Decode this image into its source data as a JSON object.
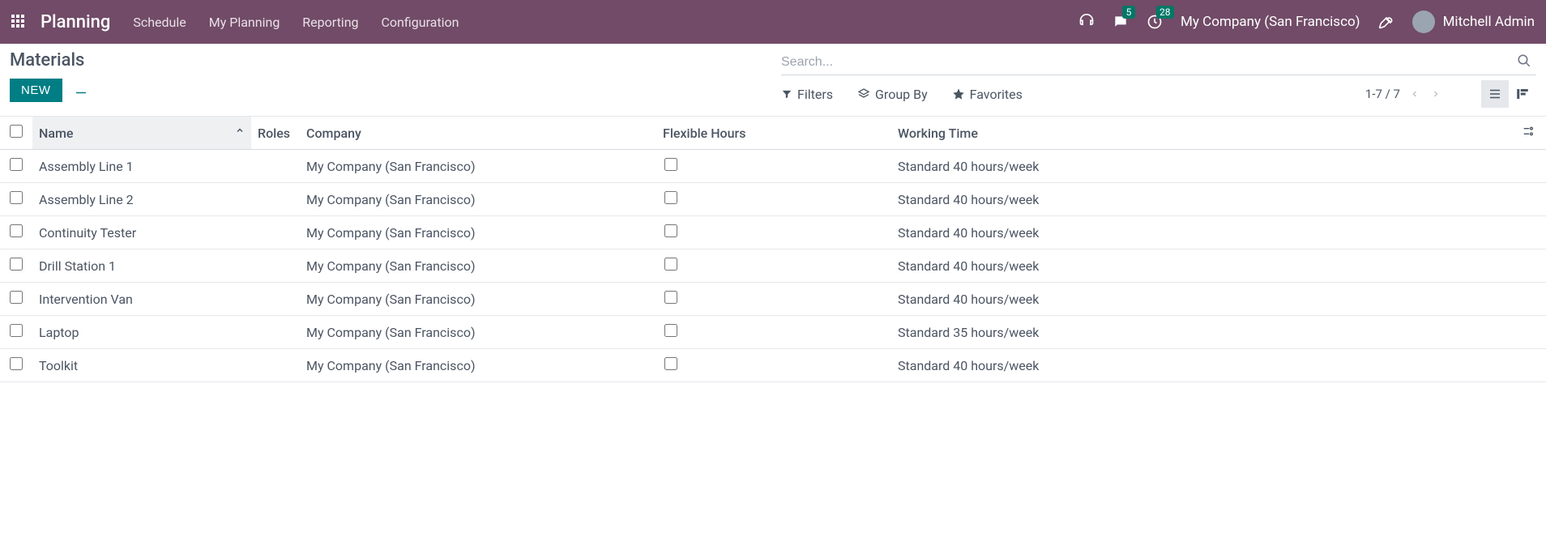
{
  "topbar": {
    "brand": "Planning",
    "nav": [
      "Schedule",
      "My Planning",
      "Reporting",
      "Configuration"
    ],
    "messages_badge": "5",
    "activities_badge": "28",
    "company": "My Company (San Francisco)",
    "user": "Mitchell Admin"
  },
  "breadcrumb": "Materials",
  "buttons": {
    "new": "NEW"
  },
  "search": {
    "placeholder": "Search..."
  },
  "toolbar": {
    "filters": "Filters",
    "groupby": "Group By",
    "favorites": "Favorites",
    "pager": "1-7 / 7"
  },
  "columns": {
    "name": "Name",
    "roles": "Roles",
    "company": "Company",
    "flexible": "Flexible Hours",
    "working": "Working Time"
  },
  "rows": [
    {
      "name": "Assembly Line 1",
      "roles": "",
      "company": "My Company (San Francisco)",
      "flexible": false,
      "working": "Standard 40 hours/week"
    },
    {
      "name": "Assembly Line 2",
      "roles": "",
      "company": "My Company (San Francisco)",
      "flexible": false,
      "working": "Standard 40 hours/week"
    },
    {
      "name": "Continuity Tester",
      "roles": "",
      "company": "My Company (San Francisco)",
      "flexible": false,
      "working": "Standard 40 hours/week"
    },
    {
      "name": "Drill Station 1",
      "roles": "",
      "company": "My Company (San Francisco)",
      "flexible": false,
      "working": "Standard 40 hours/week"
    },
    {
      "name": "Intervention Van",
      "roles": "",
      "company": "My Company (San Francisco)",
      "flexible": false,
      "working": "Standard 40 hours/week"
    },
    {
      "name": "Laptop",
      "roles": "",
      "company": "My Company (San Francisco)",
      "flexible": false,
      "working": "Standard 35 hours/week"
    },
    {
      "name": "Toolkit",
      "roles": "",
      "company": "My Company (San Francisco)",
      "flexible": false,
      "working": "Standard 40 hours/week"
    }
  ]
}
